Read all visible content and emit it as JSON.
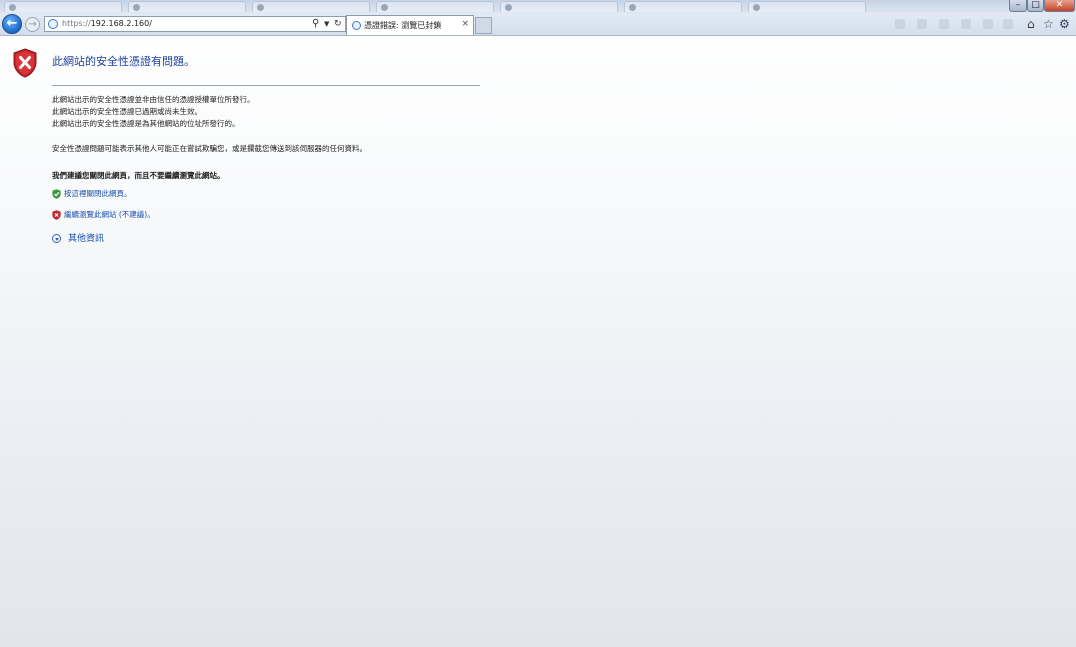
{
  "browser": {
    "address_scheme": "https://",
    "address_host": "192.168.2.160/",
    "active_tab_title": "憑證錯誤: 瀏覽已封鎖",
    "tab_close": "×"
  },
  "page": {
    "title": "此網站的安全性憑證有問題。",
    "reasons": [
      "此網站出示的安全性憑證並非由信任的憑證授權單位所發行。",
      "此網站出示的安全性憑證已過期或尚未生效。",
      "此網站出示的安全性憑證是為其他網站的位址所發行的。"
    ],
    "risk": "安全性憑證問題可能表示其他人可能正在嘗試欺騙您，或是攔截您傳送到該伺服器的任何資料。",
    "recommendation": "我們建議您關閉此網頁，而且不要繼續瀏覽此網站。",
    "close_link": "按這裡關閉此網頁。",
    "continue_link": "繼續瀏覽此網站 (不建議)。",
    "more_info": "其他資訊"
  },
  "colors": {
    "title": "#1f3f9f",
    "link": "#1a4fae",
    "shield_red": "#c0262c",
    "ok_green": "#3a9a3a"
  }
}
